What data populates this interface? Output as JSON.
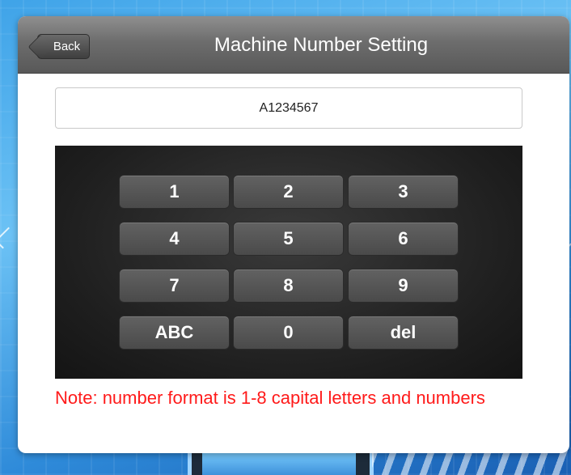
{
  "header": {
    "back_label": "Back",
    "title": "Machine Number Setting"
  },
  "machine_number": {
    "value": "A1234567"
  },
  "keypad": {
    "keys": [
      "1",
      "2",
      "3",
      "4",
      "5",
      "6",
      "7",
      "8",
      "9",
      "ABC",
      "0",
      "del"
    ]
  },
  "note": "Note: number format is 1-8 capital letters and numbers",
  "colors": {
    "header": "#6d6d6d",
    "keypad_bg": "#1e1e1e",
    "key": "#555555",
    "note_text": "#ff1a1a"
  }
}
